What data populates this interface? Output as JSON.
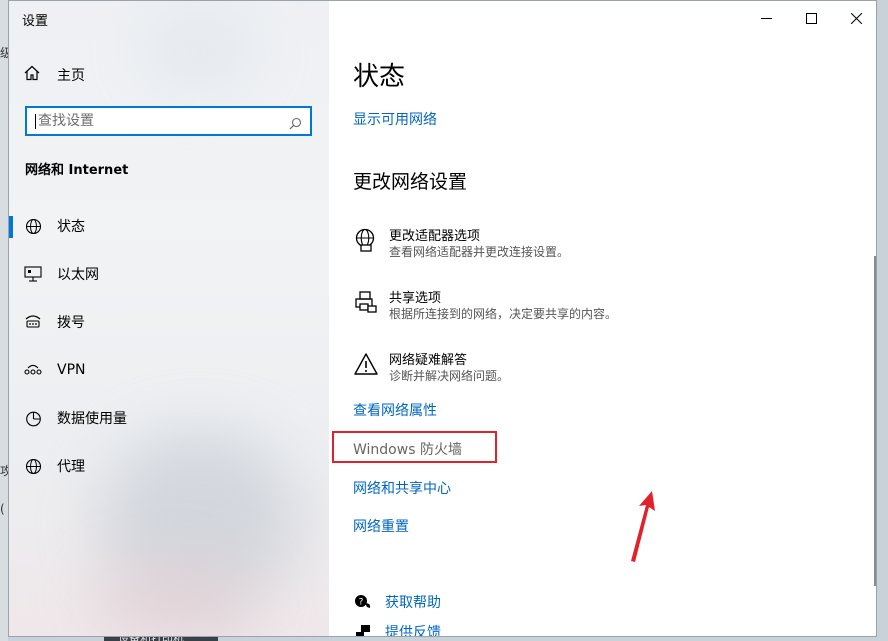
{
  "window": {
    "title": "设置"
  },
  "sidebar": {
    "home_label": "主页",
    "search_placeholder": "查找设置",
    "section_title": "网络和 Internet",
    "items": [
      {
        "label": "状态",
        "icon": "globe-icon",
        "selected": true
      },
      {
        "label": "以太网",
        "icon": "ethernet-icon"
      },
      {
        "label": "拨号",
        "icon": "dialup-icon"
      },
      {
        "label": "VPN",
        "icon": "vpn-icon"
      },
      {
        "label": "数据使用量",
        "icon": "data-usage-icon"
      },
      {
        "label": "代理",
        "icon": "globe-icon"
      }
    ]
  },
  "main": {
    "title": "状态",
    "show_networks_link": "显示可用网络",
    "change_settings_heading": "更改网络设置",
    "options": [
      {
        "title": "更改适配器选项",
        "desc": "查看网络适配器并更改连接设置。",
        "icon": "adapter-globe-icon"
      },
      {
        "title": "共享选项",
        "desc": "根据所连接到的网络，决定要共享的内容。",
        "icon": "printer-icon"
      },
      {
        "title": "网络疑难解答",
        "desc": "诊断并解决网络问题。",
        "icon": "warning-icon"
      }
    ],
    "view_properties_link": "查看网络属性",
    "firewall_link": "Windows 防火墙",
    "sharing_center_link": "网络和共享中心",
    "reset_link": "网络重置",
    "help_links": [
      {
        "label": "获取帮助",
        "icon": "help-chat-icon"
      },
      {
        "label": "提供反馈",
        "icon": "feedback-icon"
      }
    ]
  },
  "background": {
    "left_fragments": [
      "级",
      "攻",
      "("
    ],
    "taskbar_text": "设备和打印机"
  },
  "colors": {
    "accent": "#0078d7",
    "link": "#0067c0",
    "highlight": "#e0232a"
  }
}
